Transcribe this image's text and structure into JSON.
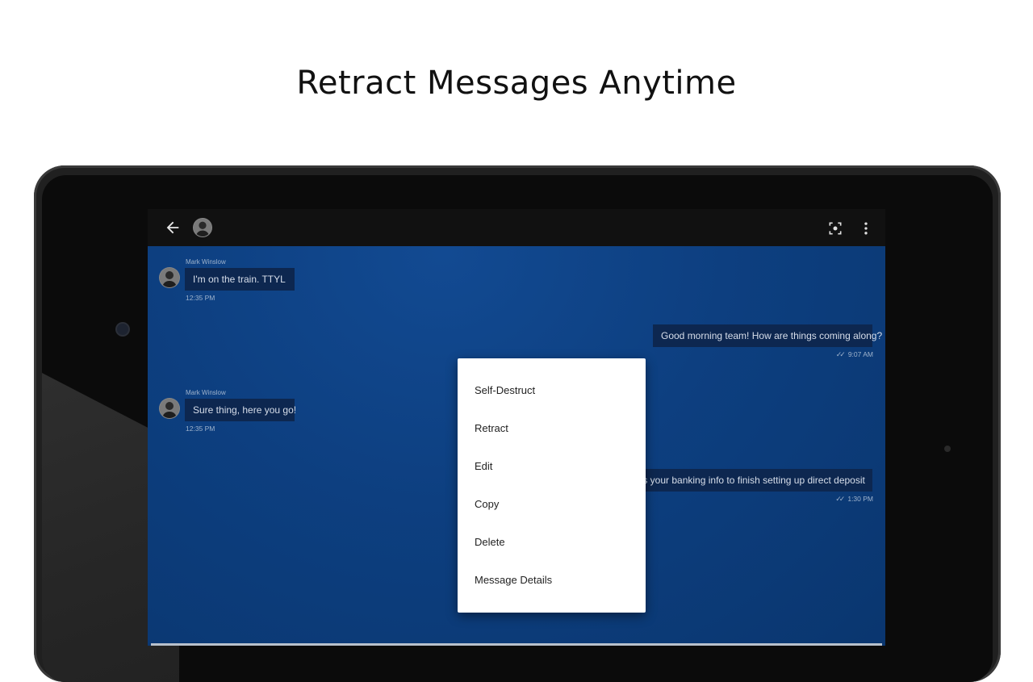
{
  "headline": "Retract Messages Anytime",
  "messages": [
    {
      "sender": "Mark Winslow",
      "text": "I'm on the train. TTYL",
      "time": "12:35 PM"
    },
    {
      "text": "Good morning team! How are things coming along?",
      "time": "9:07 AM"
    },
    {
      "sender": "Mark Winslow",
      "text": "Sure thing, here you go!",
      "time": "12:35 PM"
    },
    {
      "text": "eds your banking info to finish setting up direct deposit",
      "time": "1:30 PM"
    }
  ],
  "menu": {
    "items": [
      "Self-Destruct",
      "Retract",
      "Edit",
      "Copy",
      "Delete",
      "Message Details"
    ]
  },
  "icons": {
    "back": "arrow-left-icon",
    "avatar": "contact-avatar-icon",
    "screenshot": "screen-capture-icon",
    "more": "more-vert-icon",
    "read": "double-check-icon"
  },
  "colors": {
    "chat_bg": "#0d3f80",
    "bubble": "#0d2750",
    "appbar": "#111111",
    "menu_bg": "#ffffff"
  }
}
